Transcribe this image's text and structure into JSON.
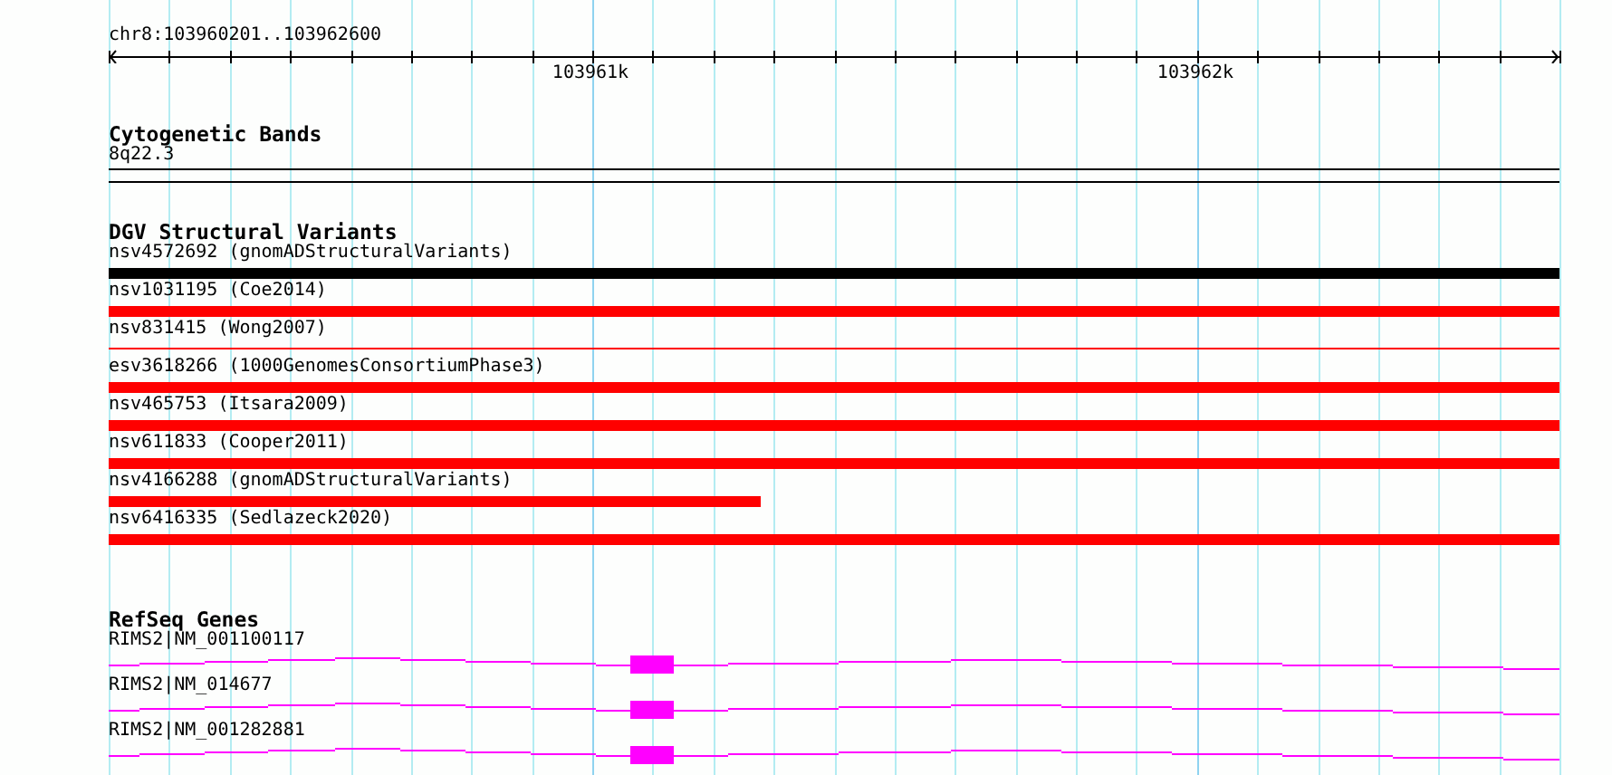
{
  "ruler": {
    "location": "chr8:103960201..103962600",
    "tick_labels": [
      "103961k",
      "103962k"
    ]
  },
  "tracks": [
    {
      "kind": "bands",
      "title": "Cytogenetic Bands",
      "features": [
        {
          "label": "8q22.3"
        }
      ]
    },
    {
      "kind": "variants",
      "title": "DGV Structural Variants",
      "features": [
        {
          "label": "nsv4572692 (gnomADStructuralVariants)",
          "color": "#000000",
          "kind": "bar"
        },
        {
          "label": "nsv1031195 (Coe2014)",
          "color": "#ff0000",
          "kind": "bar"
        },
        {
          "label": "nsv831415 (Wong2007)",
          "color": "#ff0000",
          "kind": "line"
        },
        {
          "label": "esv3618266 (1000GenomesConsortiumPhase3)",
          "color": "#ff0000",
          "kind": "bar"
        },
        {
          "label": "nsv465753 (Itsara2009)",
          "color": "#ff0000",
          "kind": "bar"
        },
        {
          "label": "nsv611833 (Cooper2011)",
          "color": "#ff0000",
          "kind": "bar"
        },
        {
          "label": "nsv4166288 (gnomADStructuralVariants)",
          "color": "#ff0000",
          "kind": "partial"
        },
        {
          "label": "nsv6416335 (Sedlazeck2020)",
          "color": "#ff0000",
          "kind": "bar"
        }
      ]
    },
    {
      "kind": "genes",
      "title": "RefSeq Genes",
      "features": [
        {
          "label": "RIMS2|NM_001100117"
        },
        {
          "label": "RIMS2|NM_014677"
        },
        {
          "label": "RIMS2|NM_001282881"
        }
      ]
    }
  ]
}
